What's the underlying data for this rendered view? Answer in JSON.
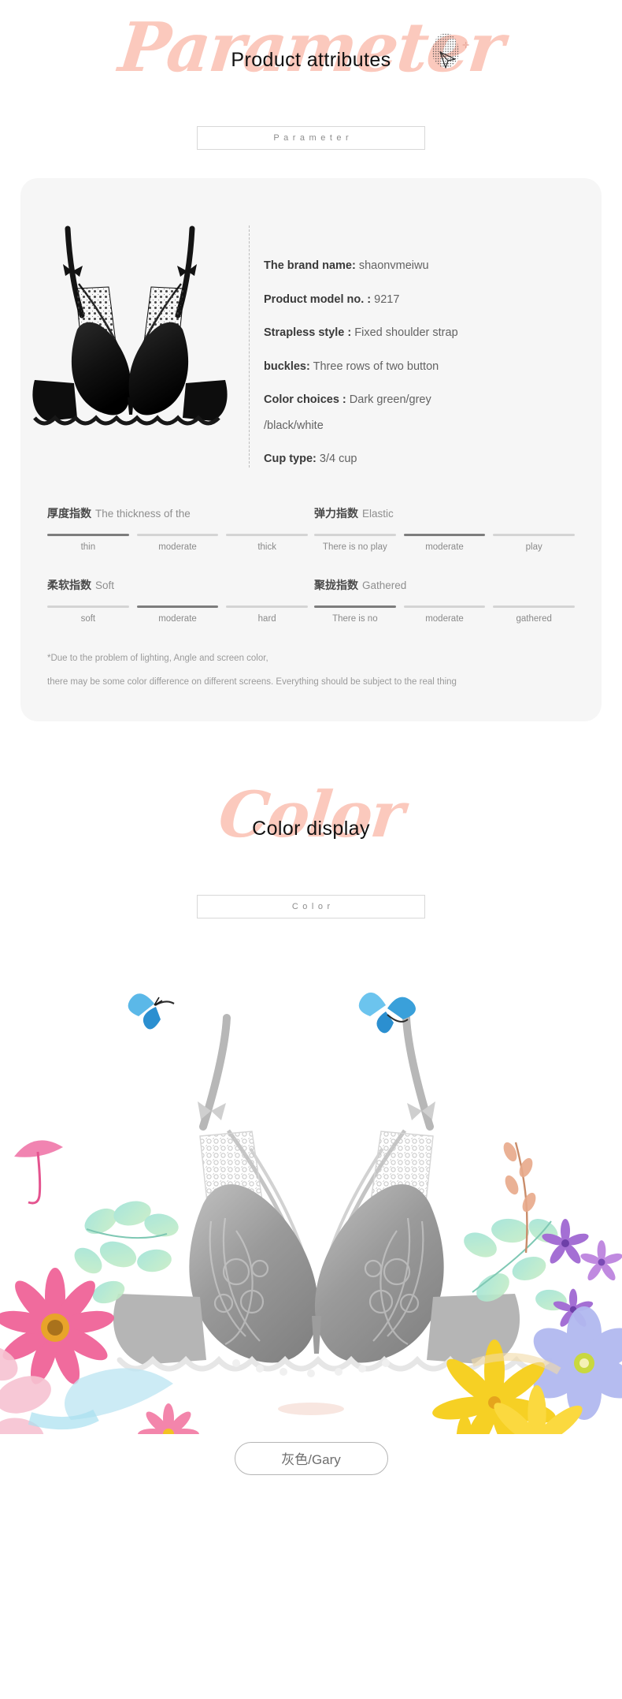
{
  "sections": {
    "parameter": {
      "script_word": "Parameter",
      "title": "Product attributes",
      "label_box": "Parameter",
      "deco_icon": "dotted-blob-cursor"
    },
    "color": {
      "script_word": "Color",
      "title": "Color display",
      "label_box": "Color"
    }
  },
  "specs": [
    {
      "label": "The brand name:",
      "value": "shaonvmeiwu"
    },
    {
      "label": "Product model no. :",
      "value": "9217"
    },
    {
      "label": "Strapless style :",
      "value": "Fixed shoulder strap"
    },
    {
      "label": "buckles:",
      "value": "Three rows of two button"
    },
    {
      "label": "Color choices :",
      "value": "Dark green/grey"
    },
    {
      "label": "",
      "value": "/black/white"
    },
    {
      "label": "Cup type:",
      "value": "3/4 cup"
    }
  ],
  "indices": [
    {
      "cn": "厚度指数",
      "en": "The thickness of the",
      "options": [
        "thin",
        "moderate",
        "thick"
      ],
      "selected": 0
    },
    {
      "cn": "弹力指数",
      "en": "Elastic",
      "options": [
        "There is no play",
        "moderate",
        "play"
      ],
      "selected": 1
    },
    {
      "cn": "柔软指数",
      "en": "Soft",
      "options": [
        "soft",
        "moderate",
        "hard"
      ],
      "selected": 1
    },
    {
      "cn": "聚拢指数",
      "en": "Gathered",
      "options": [
        "There is no",
        "moderate",
        "gathered"
      ],
      "selected": 0
    }
  ],
  "note": {
    "line1": "*Due to the problem of lighting, Angle and screen color,",
    "line2": "there may be some color difference on different screens. Everything should be subject to the real thing"
  },
  "color_display": {
    "caption": "灰色/Gary"
  },
  "colors": {
    "script_pink": "#fbc9bd",
    "card_bg": "#f6f6f6",
    "bar_active": "#7d7d7d",
    "bar_inactive": "#d4d4d4",
    "text_dark": "#3a3a3a",
    "text_muted": "#8a8a8a"
  }
}
